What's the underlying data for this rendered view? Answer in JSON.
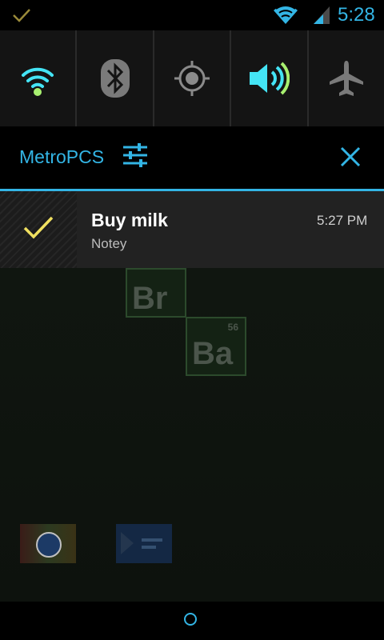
{
  "status_bar": {
    "time": "5:28",
    "icons": [
      "check-icon",
      "wifi-icon",
      "signal-icon"
    ]
  },
  "quick_settings": {
    "tiles": [
      {
        "icon": "wifi-icon",
        "active": true
      },
      {
        "icon": "bluetooth-icon",
        "active": false
      },
      {
        "icon": "location-icon",
        "active": false
      },
      {
        "icon": "volume-icon",
        "active": true
      },
      {
        "icon": "airplane-icon",
        "active": false
      }
    ]
  },
  "header": {
    "carrier": "MetroPCS"
  },
  "notification": {
    "title": "Buy milk",
    "app": "Notey",
    "time": "5:27 PM"
  },
  "wallpaper": {
    "elements": [
      {
        "symbol": "Br",
        "number": ""
      },
      {
        "symbol": "Ba",
        "number": "56"
      }
    ]
  },
  "colors": {
    "accent": "#33b5e5",
    "active_tile": "#44e4f5",
    "check": "#f0e060"
  }
}
